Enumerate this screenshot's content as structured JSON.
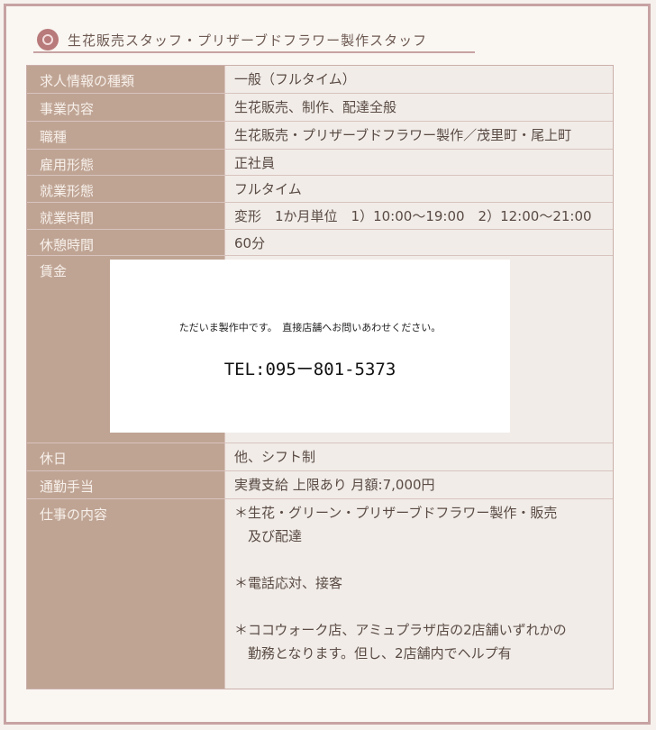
{
  "header": {
    "title": "生花販売スタッフ・プリザーブドフラワー製作スタッフ"
  },
  "rows": [
    {
      "label": "求人情報の種類",
      "value": "一般（フルタイム）"
    },
    {
      "label": "事業内容",
      "value": "生花販売、制作、配達全般"
    },
    {
      "label": "職種",
      "value": "生花販売・プリザーブドフラワー製作／茂里町・尾上町"
    },
    {
      "label": "雇用形態",
      "value": "正社員"
    },
    {
      "label": "就業形態",
      "value": "フルタイム"
    },
    {
      "label": "就業時間",
      "value": "変形　1か月単位　1）10:00～19:00　2）12:00～21:00"
    },
    {
      "label": "休憩時間",
      "value": "60分"
    },
    {
      "label": "賃金",
      "value": ""
    },
    {
      "label": "休日",
      "value": "他、シフト制"
    },
    {
      "label": "通勤手当",
      "value": "実費支給 上限あり 月額:7,000円"
    },
    {
      "label": "仕事の内容",
      "lines": [
        "＊生花・グリーン・プリザーブドフラワー製作・販売",
        "　及び配達",
        "",
        "＊電話応対、接客",
        "",
        "＊ココウォーク店、アミュプラザ店の2店舗いずれかの",
        "　勤務となります。但し、2店舗内でヘルプ有"
      ]
    }
  ],
  "notice": {
    "message": "ただいま製作中です。　直接店舗へお問いあわせください。",
    "tel": "TEL:095ー801-5373"
  }
}
